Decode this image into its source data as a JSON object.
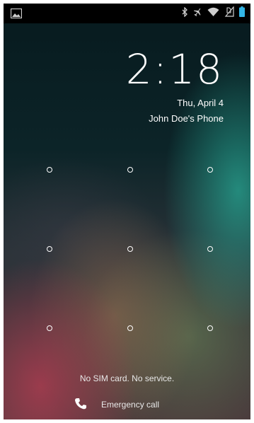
{
  "status_bar": {
    "left_icon": "image-notification-icon",
    "right_icons": [
      "bluetooth-icon",
      "airplane-mode-icon",
      "wifi-icon",
      "no-sim-icon",
      "battery-icon"
    ],
    "colors": {
      "background": "#000000",
      "icon": "#cfcfcf",
      "battery": "#33b5e5"
    }
  },
  "lockscreen": {
    "time": "2:18",
    "date": "Thu, April 4",
    "owner_info": "John Doe's Phone",
    "pattern_dots_count": 9,
    "carrier_text": "No SIM card. No service.",
    "emergency_label": "Emergency call",
    "emergency_icon": "phone-icon"
  }
}
